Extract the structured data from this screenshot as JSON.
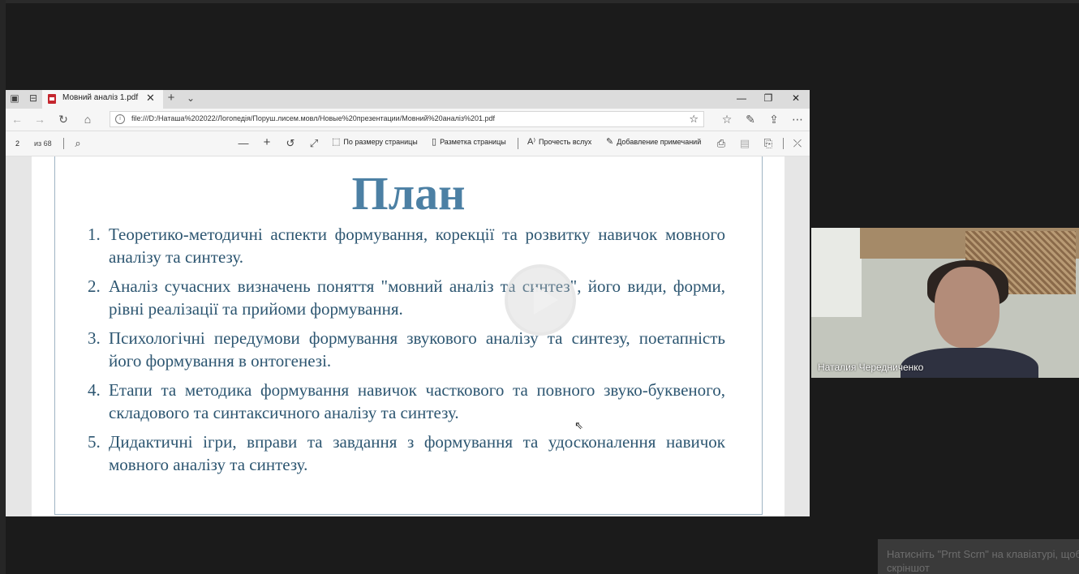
{
  "browser": {
    "tab_title": "Мовний аналіз 1.pdf",
    "url": "file:///D:/Наташа%202022/Логопедія/Поруш.лисем.мовл/Новые%20презентации/Мовний%20аналіз%201.pdf"
  },
  "pdf_toolbar": {
    "page": "2",
    "of_pages": "из 68",
    "fit_page": "По размеру страницы",
    "page_layout": "Разметка страницы",
    "read_aloud": "Прочесть вслух",
    "add_notes": "Добавление примечаний"
  },
  "slide": {
    "title": "План",
    "items": [
      {
        "num": "1.",
        "text": "Теоретико-методичні аспекти формування, корекції та розвитку навичок мовного аналізу та синтезу."
      },
      {
        "num": "2.",
        "text": "Аналіз сучасних визначень поняття \"мовний аналіз та синтез\", його види, форми, рівні реалізації та прийоми формування."
      },
      {
        "num": "3.",
        "text": "Психологічні передумови формування звукового аналізу та синтезу, поетапність його формування в онтогенезі."
      },
      {
        "num": "4.",
        "text": "Етапи та методика формування навичок часткового та повного звуко-буквеного, складового та синтаксичного аналізу та синтезу."
      },
      {
        "num": "5.",
        "text": "Дидактичні ігри, вправи та завдання з формування та удосконалення навичок мовного аналізу та синтезу."
      }
    ]
  },
  "participant": {
    "name": "Наталия Чередниченко"
  },
  "notification": {
    "text": "Натисніть \"Prnt Scrn\" на клавіатурі, щоб зробити скріншот"
  }
}
